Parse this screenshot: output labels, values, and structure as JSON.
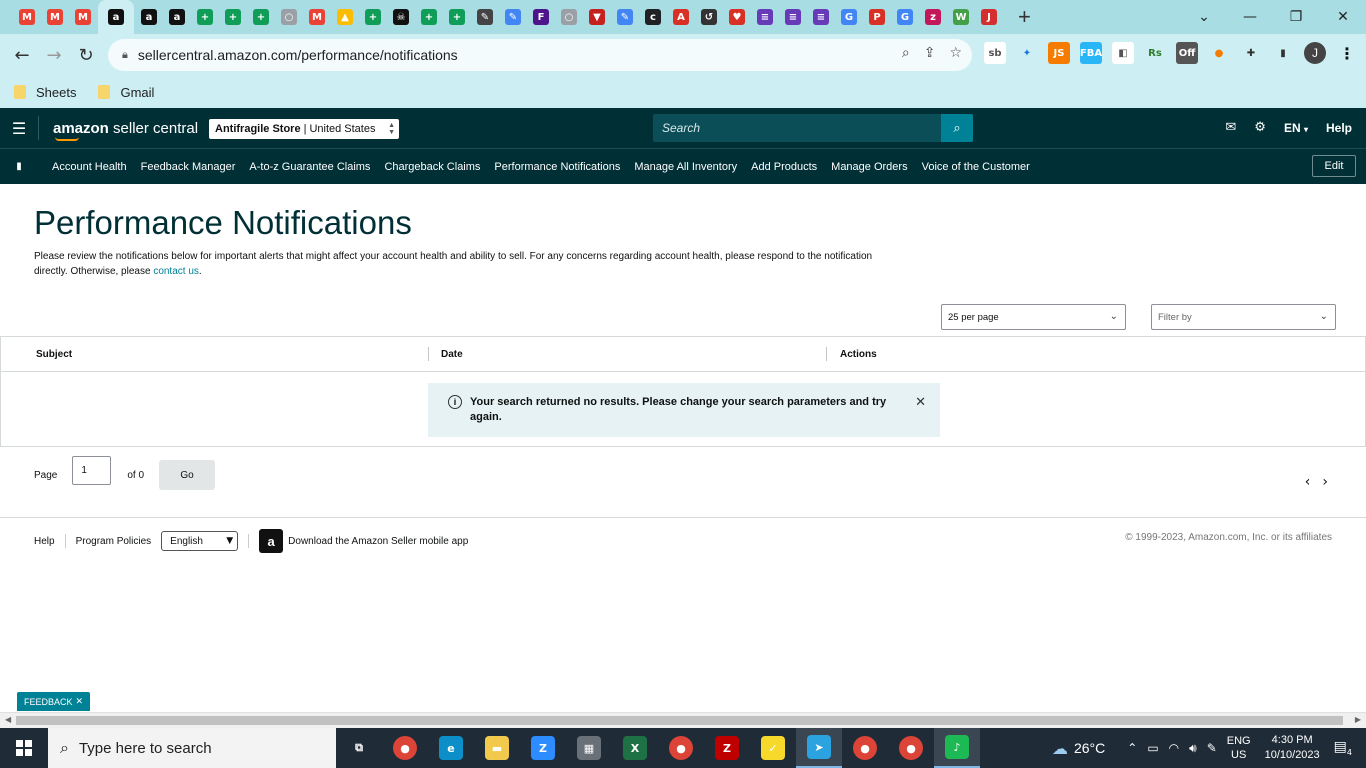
{
  "browser": {
    "tabs": [
      {
        "icon": "gmail-icon",
        "letter": "M",
        "color": "#ea4335"
      },
      {
        "icon": "gmail-icon",
        "letter": "M",
        "color": "#ea4335"
      },
      {
        "icon": "gmail-icon",
        "letter": "M",
        "color": "#ea4335"
      },
      {
        "icon": "amazon-icon",
        "letter": "a",
        "color": "#111111"
      },
      {
        "icon": "amazon-icon",
        "letter": "a",
        "color": "#111111"
      },
      {
        "icon": "amazon-icon",
        "letter": "a",
        "color": "#111111"
      },
      {
        "icon": "sheets-plus-icon",
        "letter": "+",
        "color": "#0f9d58"
      },
      {
        "icon": "sheets-plus-icon",
        "letter": "+",
        "color": "#0f9d58"
      },
      {
        "icon": "sheets-plus-icon",
        "letter": "+",
        "color": "#0f9d58"
      },
      {
        "icon": "globe-icon",
        "letter": "○",
        "color": "#9aa0a6"
      },
      {
        "icon": "gmail-icon",
        "letter": "M",
        "color": "#ea4335"
      },
      {
        "icon": "drive-icon",
        "letter": "▲",
        "color": "#fbbc04"
      },
      {
        "icon": "sheets-plus-icon",
        "letter": "+",
        "color": "#0f9d58"
      },
      {
        "icon": "pirate-icon",
        "letter": "☠",
        "color": "#111111"
      },
      {
        "icon": "sheets-plus-icon",
        "letter": "+",
        "color": "#0f9d58"
      },
      {
        "icon": "sheets-plus-icon",
        "letter": "+",
        "color": "#0f9d58"
      },
      {
        "icon": "pen-icon",
        "letter": "✎",
        "color": "#444444"
      },
      {
        "icon": "pencil-icon",
        "letter": "✎",
        "color": "#4285f4"
      },
      {
        "icon": "fedex-icon",
        "letter": "F",
        "color": "#4d148c"
      },
      {
        "icon": "globe-icon",
        "letter": "○",
        "color": "#9aa0a6"
      },
      {
        "icon": "shield-icon",
        "letter": "▼",
        "color": "#c5221f"
      },
      {
        "icon": "pencil-icon",
        "letter": "✎",
        "color": "#4285f4"
      },
      {
        "icon": "c-icon",
        "letter": "c",
        "color": "#202124"
      },
      {
        "icon": "tab-icon",
        "letter": "A",
        "color": "#d93025"
      },
      {
        "icon": "history-icon",
        "letter": "↺",
        "color": "#333333"
      },
      {
        "icon": "heart-icon",
        "letter": "♥",
        "color": "#d93025"
      },
      {
        "icon": "forms-icon",
        "letter": "≡",
        "color": "#673ab7"
      },
      {
        "icon": "forms-icon",
        "letter": "≡",
        "color": "#673ab7"
      },
      {
        "icon": "forms-icon",
        "letter": "≡",
        "color": "#673ab7"
      },
      {
        "icon": "google-icon",
        "letter": "G",
        "color": "#4285f4"
      },
      {
        "icon": "pdf-icon",
        "letter": "P",
        "color": "#d93025"
      },
      {
        "icon": "google-icon",
        "letter": "G",
        "color": "#4285f4"
      },
      {
        "icon": "zoho-icon",
        "letter": "z",
        "color": "#c2185b"
      },
      {
        "icon": "w-icon",
        "letter": "W",
        "color": "#43a047"
      },
      {
        "icon": "jc-icon",
        "letter": "J",
        "color": "#d32f2f"
      }
    ],
    "active_tab_index": 3,
    "url": "sellercentral.amazon.com/performance/notifications",
    "extensions": [
      {
        "icon": "sellerboard-icon",
        "text": "sb",
        "color": "#555555",
        "bg": "#ffffff"
      },
      {
        "icon": "network-icon",
        "text": "✦",
        "color": "#1a73e8",
        "bg": "transparent"
      },
      {
        "icon": "js-icon",
        "text": "JS",
        "color": "#ffffff",
        "bg": "#f57c00"
      },
      {
        "icon": "fba-icon",
        "text": "FBA",
        "color": "#ffffff",
        "bg": "#29b6f6"
      },
      {
        "icon": "calc-icon",
        "text": "◧",
        "color": "#555555",
        "bg": "#ffffff"
      },
      {
        "icon": "rs-icon",
        "text": "Rs",
        "color": "#2e7d32",
        "bg": "transparent"
      },
      {
        "icon": "off-icon",
        "text": "Off",
        "color": "#ffffff",
        "bg": "#555555"
      },
      {
        "icon": "orange-circle-icon",
        "text": "●",
        "color": "#f57c00",
        "bg": "transparent"
      },
      {
        "icon": "puzzle-icon",
        "text": "✚",
        "color": "#333333",
        "bg": "transparent"
      },
      {
        "icon": "sidepanel-icon",
        "text": "▮",
        "color": "#333333",
        "bg": "transparent"
      }
    ],
    "profile_letter": "J",
    "bookmarks": [
      "Sheets",
      "Gmail"
    ]
  },
  "header": {
    "logo_main": "amazon",
    "logo_sub": "seller central",
    "store": "Antifragile Store",
    "marketplace": "United States",
    "search_placeholder": "Search",
    "language": "EN",
    "help": "Help"
  },
  "nav": {
    "items": [
      "Account Health",
      "Feedback Manager",
      "A-to-z Guarantee Claims",
      "Chargeback Claims",
      "Performance Notifications",
      "Manage All Inventory",
      "Add Products",
      "Manage Orders",
      "Voice of the Customer"
    ],
    "edit": "Edit"
  },
  "page": {
    "title": "Performance Notifications",
    "desc_text": "Please review the notifications below for important alerts that might affect your account health and ability to sell. For any concerns regarding account health, please respond to the notification directly. Otherwise, please ",
    "desc_link": "contact us",
    "desc_end": ".",
    "per_page": "25 per page",
    "filter_placeholder": "Filter by",
    "columns": [
      "Subject",
      "Date",
      "Actions"
    ],
    "alert": "Your search returned no results. Please change your search parameters and try again.",
    "pager": {
      "label": "Page",
      "value": "1",
      "of_text": "of 0",
      "go": "Go"
    }
  },
  "footer": {
    "help": "Help",
    "policies": "Program Policies",
    "language": "English",
    "app_text": "Download the Amazon Seller mobile app",
    "copyright": "© 1999-2023, Amazon.com, Inc. or its affiliates",
    "feedback": "FEEDBACK"
  },
  "taskbar": {
    "search_placeholder": "Type here to search",
    "apps": [
      {
        "icon": "task-view-icon",
        "text": "⧉",
        "bg": "transparent"
      },
      {
        "icon": "chrome-icon",
        "text": "●",
        "bg": "#db4437"
      },
      {
        "icon": "edge-icon",
        "text": "e",
        "bg": "#0c8fc9"
      },
      {
        "icon": "file-explorer-icon",
        "text": "▬",
        "bg": "#f2c94c"
      },
      {
        "icon": "zoom-icon",
        "text": "Z",
        "bg": "#2d8cff"
      },
      {
        "icon": "calculator-icon",
        "text": "▦",
        "bg": "#6a7077"
      },
      {
        "icon": "excel-icon",
        "text": "X",
        "bg": "#1e7145"
      },
      {
        "icon": "chrome-icon",
        "text": "●",
        "bg": "#db4437"
      },
      {
        "icon": "filezilla-icon",
        "text": "Z",
        "bg": "#bf0000"
      },
      {
        "icon": "sticky-notes-icon",
        "text": "✓",
        "bg": "#f7d92b"
      },
      {
        "icon": "telegram-icon",
        "text": "➤",
        "bg": "#2aa3e0"
      },
      {
        "icon": "chrome-icon",
        "text": "●",
        "bg": "#db4437"
      },
      {
        "icon": "chrome-icon",
        "text": "●",
        "bg": "#db4437"
      },
      {
        "icon": "spotify-icon",
        "text": "♪",
        "bg": "#1db954"
      }
    ],
    "active_app_indices": [
      10,
      13
    ],
    "temperature": "26°C",
    "lang_top": "ENG",
    "lang_bottom": "US",
    "time": "4:30 PM",
    "date": "10/10/2023",
    "notification_count": "4"
  }
}
